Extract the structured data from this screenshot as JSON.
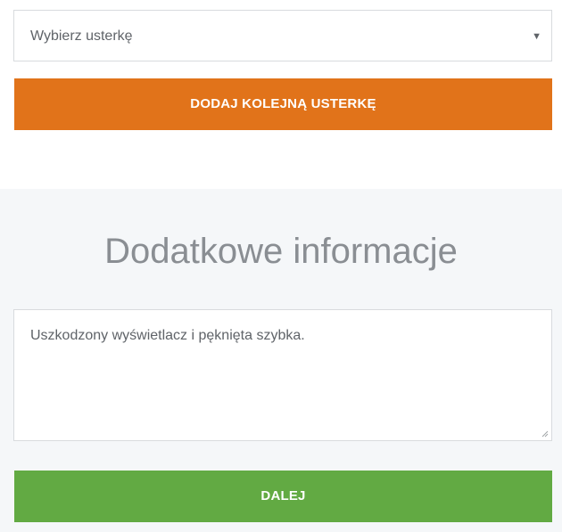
{
  "defect_select": {
    "selected_value": "Wybierz usterkę",
    "arrow_icon": "caret-down-icon"
  },
  "add_defect_button": {
    "label": "DODAJ KOLEJNĄ USTERKĘ",
    "color": "#e1731a"
  },
  "additional_info": {
    "title": "Dodatkowe informacje",
    "textarea_value": "Uszkodzony wyświetlacz i pęknięta szybka."
  },
  "next_button": {
    "label": "DALEJ",
    "color": "#62aa43"
  }
}
